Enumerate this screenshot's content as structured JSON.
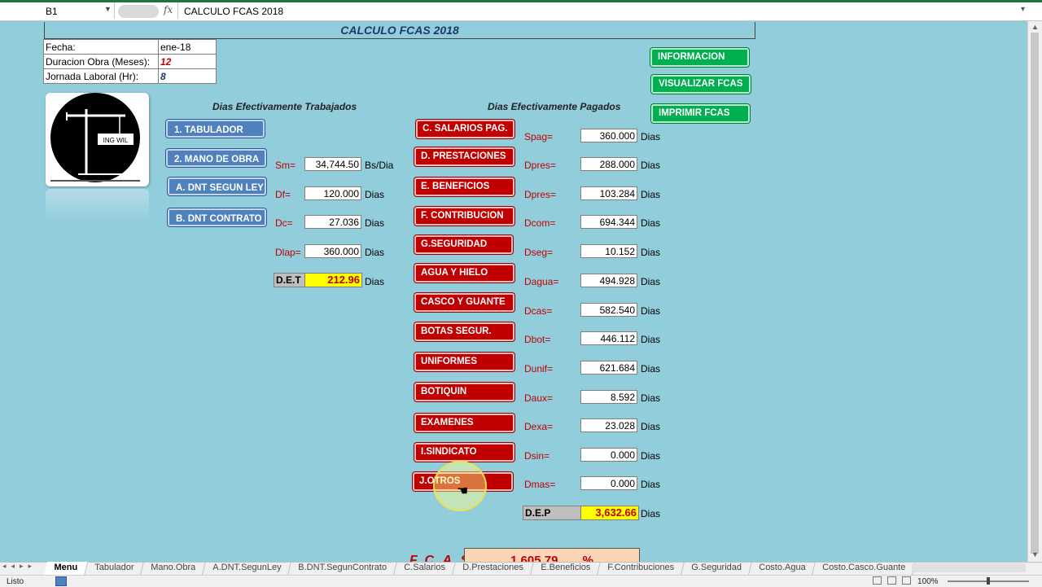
{
  "formula_bar": {
    "name_box": "B1",
    "fx": "fx",
    "content": "CALCULO FCAS 2018"
  },
  "sheet_title": "CALCULO FCAS 2018",
  "info": [
    {
      "label": "Fecha:",
      "value": "ene-18"
    },
    {
      "label": "Duracion Obra (Meses):",
      "value": "12"
    },
    {
      "label": "Jornada Laboral (Hr):",
      "value": "8"
    }
  ],
  "logo": {
    "text": "ING WIL"
  },
  "left_section": {
    "heading": "Dias Efectivamente Trabajados",
    "buttons": [
      "1. TABULADOR",
      "2. MANO DE OBRA",
      "A. DNT SEGUN LEY",
      "B. DNT CONTRATO"
    ],
    "rows": [
      {
        "label": "Sm=",
        "value": "34,744.50",
        "unit": "Bs/Dia"
      },
      {
        "label": "Df=",
        "value": "120.000",
        "unit": "Dias"
      },
      {
        "label": "Dc=",
        "value": "27.036",
        "unit": "Dias"
      },
      {
        "label": "Dlap=",
        "value": "360.000",
        "unit": "Dias"
      }
    ],
    "summary": {
      "label": "D.E.T",
      "value": "212.96",
      "unit": "Dias"
    }
  },
  "right_section": {
    "heading": "Dias Efectivamente Pagados",
    "buttons": [
      "C. SALARIOS PAG.",
      "D. PRESTACIONES",
      "E. BENEFICIOS",
      "F. CONTRIBUCION",
      "G.SEGURIDAD",
      "AGUA Y HIELO",
      "CASCO Y GUANTE",
      "BOTAS SEGUR.",
      "UNIFORMES",
      "BOTIQUIN",
      "EXAMENES",
      "I.SINDICATO",
      "J.OTROS"
    ],
    "rows": [
      {
        "label": "Spag=",
        "value": "360.000",
        "unit": "Dias"
      },
      {
        "label": "Dpres=",
        "value": "288.000",
        "unit": "Dias"
      },
      {
        "label": "Dpres=",
        "value": "103.284",
        "unit": "Dias"
      },
      {
        "label": "Dcom=",
        "value": "694.344",
        "unit": "Dias"
      },
      {
        "label": "Dseg=",
        "value": "10.152",
        "unit": "Dias"
      },
      {
        "label": "Dagua=",
        "value": "494.928",
        "unit": "Dias"
      },
      {
        "label": "Dcas=",
        "value": "582.540",
        "unit": "Dias"
      },
      {
        "label": "Dbot=",
        "value": "446.112",
        "unit": "Dias"
      },
      {
        "label": "Dunif=",
        "value": "621.684",
        "unit": "Dias"
      },
      {
        "label": "Daux=",
        "value": "8.592",
        "unit": "Dias"
      },
      {
        "label": "Dexa=",
        "value": "23.028",
        "unit": "Dias"
      },
      {
        "label": "Dsin=",
        "value": "0.000",
        "unit": "Dias"
      },
      {
        "label": "Dmas=",
        "value": "0.000",
        "unit": "Dias"
      }
    ],
    "summary": {
      "label": "D.E.P",
      "value": "3,632.66",
      "unit": "Dias"
    }
  },
  "action_buttons": [
    "INFORMACION",
    "VISUALIZAR FCAS",
    "IMPRIMIR FCAS"
  ],
  "fcas": {
    "label": "F.C.A.S",
    "value": "1,605.79",
    "unit": "%"
  },
  "tabs": [
    "Menu",
    "Tabulador",
    "Mano.Obra",
    "A.DNT.SegunLey",
    "B.DNT.SegunContrato",
    "C.Salarios",
    "D.Prestaciones",
    "E.Beneficios",
    "F.Contribuciones",
    "G.Seguridad",
    "Costo.Agua",
    "Costo.Casco.Guante"
  ],
  "status": {
    "text": "Listo",
    "zoom": "100%"
  },
  "colors": {
    "sheet_bg": "#92cddc",
    "red_button": "#c00000",
    "blue_button": "#4f81bd",
    "green_button": "#00b050",
    "highlight": "#ffff00"
  }
}
